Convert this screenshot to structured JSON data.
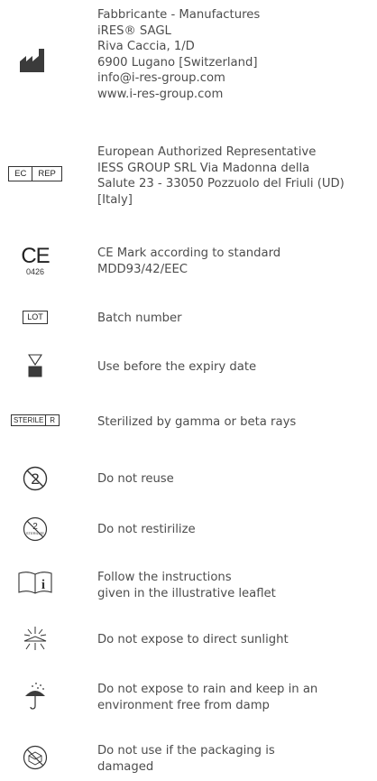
{
  "manufacturer": {
    "icon": "factory-icon",
    "lines": [
      "Fabbricante - Manufactures",
      "iRES® SAGL",
      "Riva Caccia, 1/D",
      "6900 Lugano [Switzerland]",
      "info@i-res-group.com",
      "www.i-res-group.com"
    ]
  },
  "ec_rep": {
    "symbol_left": "EC",
    "symbol_right": "REP",
    "lines": [
      "European Authorized Representative",
      "IESS GROUP SRL Via Madonna della",
      "Salute 23 - 33050 Pozzuolo del Friuli (UD)",
      "[Italy]"
    ]
  },
  "ce": {
    "mark": "CE",
    "number": "0426",
    "lines": [
      "CE Mark according to standard",
      "MDD93/42/EEC"
    ]
  },
  "lot": {
    "symbol": "LOT",
    "lines": [
      "Batch number"
    ]
  },
  "expiry": {
    "icon": "hourglass-icon",
    "lines": [
      "Use before the expiry date"
    ]
  },
  "sterile": {
    "symbol_left": "STERILE",
    "symbol_right": "R",
    "lines": [
      "Sterilized by gamma or beta rays"
    ]
  },
  "no_reuse": {
    "icon": "do-not-reuse-icon",
    "glyph": "2",
    "lines": [
      "Do not reuse"
    ]
  },
  "no_restirilize": {
    "icon": "do-not-resterilize-icon",
    "glyph": "2",
    "small": "STERILIZE",
    "lines": [
      "Do not restirilize"
    ]
  },
  "instructions": {
    "icon": "instructions-book-icon",
    "glyph": "i",
    "lines": [
      "Follow the instructions",
      "given in the illustrative leaflet"
    ]
  },
  "sunlight": {
    "icon": "keep-away-from-sunlight-icon",
    "lines": [
      "Do not expose to direct sunlight"
    ]
  },
  "rain": {
    "icon": "keep-dry-umbrella-icon",
    "lines": [
      "Do not expose to rain and keep in an",
      "environment free from damp"
    ]
  },
  "damaged": {
    "icon": "do-not-use-if-damaged-icon",
    "lines": [
      "Do not use if the packaging is",
      "damaged"
    ]
  }
}
